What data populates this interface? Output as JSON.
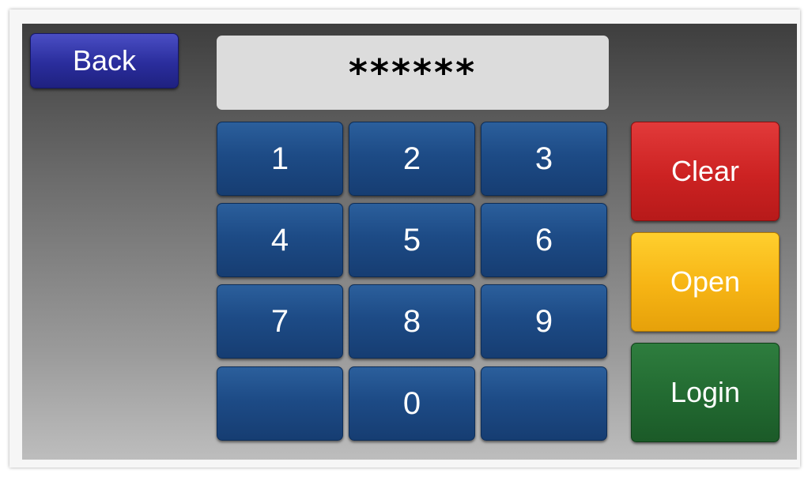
{
  "header": {
    "back_label": "Back"
  },
  "display": {
    "value": "******"
  },
  "keypad": {
    "keys": [
      "1",
      "2",
      "3",
      "4",
      "5",
      "6",
      "7",
      "8",
      "9",
      "",
      "0",
      ""
    ]
  },
  "actions": {
    "clear_label": "Clear",
    "open_label": "Open",
    "login_label": "Login"
  },
  "colors": {
    "back": "#2a2d9c",
    "keypad": "#1d4b86",
    "clear": "#cc2222",
    "open": "#f6b414",
    "login": "#226a31",
    "display": "#dcdcdc"
  }
}
